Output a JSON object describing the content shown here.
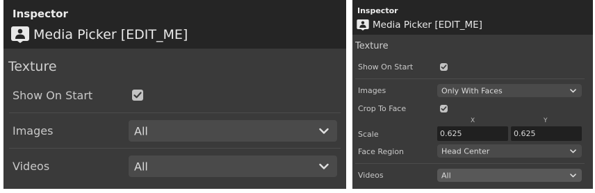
{
  "left": {
    "inspector_title": "Inspector",
    "component_icon": "media-picker-icon",
    "component_title": "Media Picker [EDIT_ME]",
    "section": "Texture",
    "show_on_start": {
      "label": "Show On Start",
      "checked": true
    },
    "images": {
      "label": "Images",
      "value": "All"
    },
    "videos": {
      "label": "Videos",
      "value": "All"
    }
  },
  "right": {
    "inspector_title": "Inspector",
    "component_icon": "media-picker-icon",
    "component_title": "Media Picker [EDIT_ME]",
    "section": "Texture",
    "show_on_start": {
      "label": "Show On Start",
      "checked": true
    },
    "images": {
      "label": "Images",
      "value": "Only With Faces"
    },
    "crop_to_face": {
      "label": "Crop To Face",
      "checked": true
    },
    "scale": {
      "label": "Scale",
      "x_label": "X",
      "y_label": "Y",
      "x": "0.625",
      "y": "0.625"
    },
    "face_region": {
      "label": "Face Region",
      "value": "Head Center"
    },
    "videos": {
      "label": "Videos",
      "value": "All"
    }
  },
  "colors": {
    "panel_bg": "#3a3a3a",
    "header_bg": "#252525",
    "dropdown_bg": "#4a4a4a",
    "field_bg": "#202020",
    "checkbox_bg": "#c3c3c3"
  }
}
